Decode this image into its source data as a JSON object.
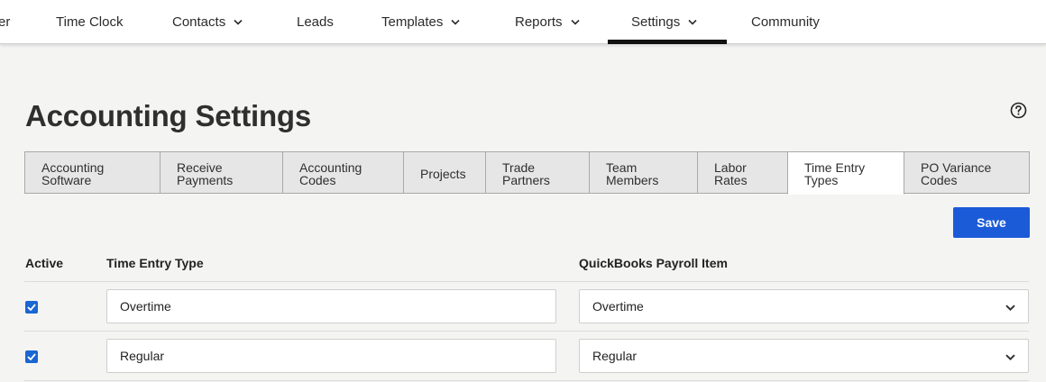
{
  "nav": {
    "items": [
      {
        "label": "er",
        "has_dropdown": false
      },
      {
        "label": "Time Clock",
        "has_dropdown": false
      },
      {
        "label": "Contacts",
        "has_dropdown": true
      },
      {
        "label": "Leads",
        "has_dropdown": false
      },
      {
        "label": "Templates",
        "has_dropdown": true
      },
      {
        "label": "Reports",
        "has_dropdown": true
      },
      {
        "label": "Settings",
        "has_dropdown": true,
        "active": true
      },
      {
        "label": "Community",
        "has_dropdown": false
      }
    ]
  },
  "page": {
    "title": "Accounting Settings",
    "help_icon": "question-circle-icon"
  },
  "tabs": [
    {
      "line1": "Accounting",
      "line2": "Software"
    },
    {
      "line1": "Receive",
      "line2": "Payments"
    },
    {
      "line1": "Accounting",
      "line2": "Codes"
    },
    {
      "line1": "Projects",
      "line2": ""
    },
    {
      "line1": "Trade",
      "line2": "Partners"
    },
    {
      "line1": "Team",
      "line2": "Members"
    },
    {
      "line1": "Labor",
      "line2": "Rates"
    },
    {
      "line1": "Time Entry",
      "line2": "Types",
      "active": true
    },
    {
      "line1": "PO Variance",
      "line2": "Codes"
    }
  ],
  "actions": {
    "save_label": "Save"
  },
  "table": {
    "headers": {
      "active": "Active",
      "type": "Time Entry Type",
      "payroll": "QuickBooks Payroll Item"
    },
    "rows": [
      {
        "active": true,
        "type": "Overtime",
        "payroll": "Overtime"
      },
      {
        "active": true,
        "type": "Regular",
        "payroll": "Regular"
      }
    ]
  },
  "colors": {
    "accent": "#1c5bd8",
    "checkbox": "#1a66d2",
    "active_tab_indicator": "#111111"
  }
}
